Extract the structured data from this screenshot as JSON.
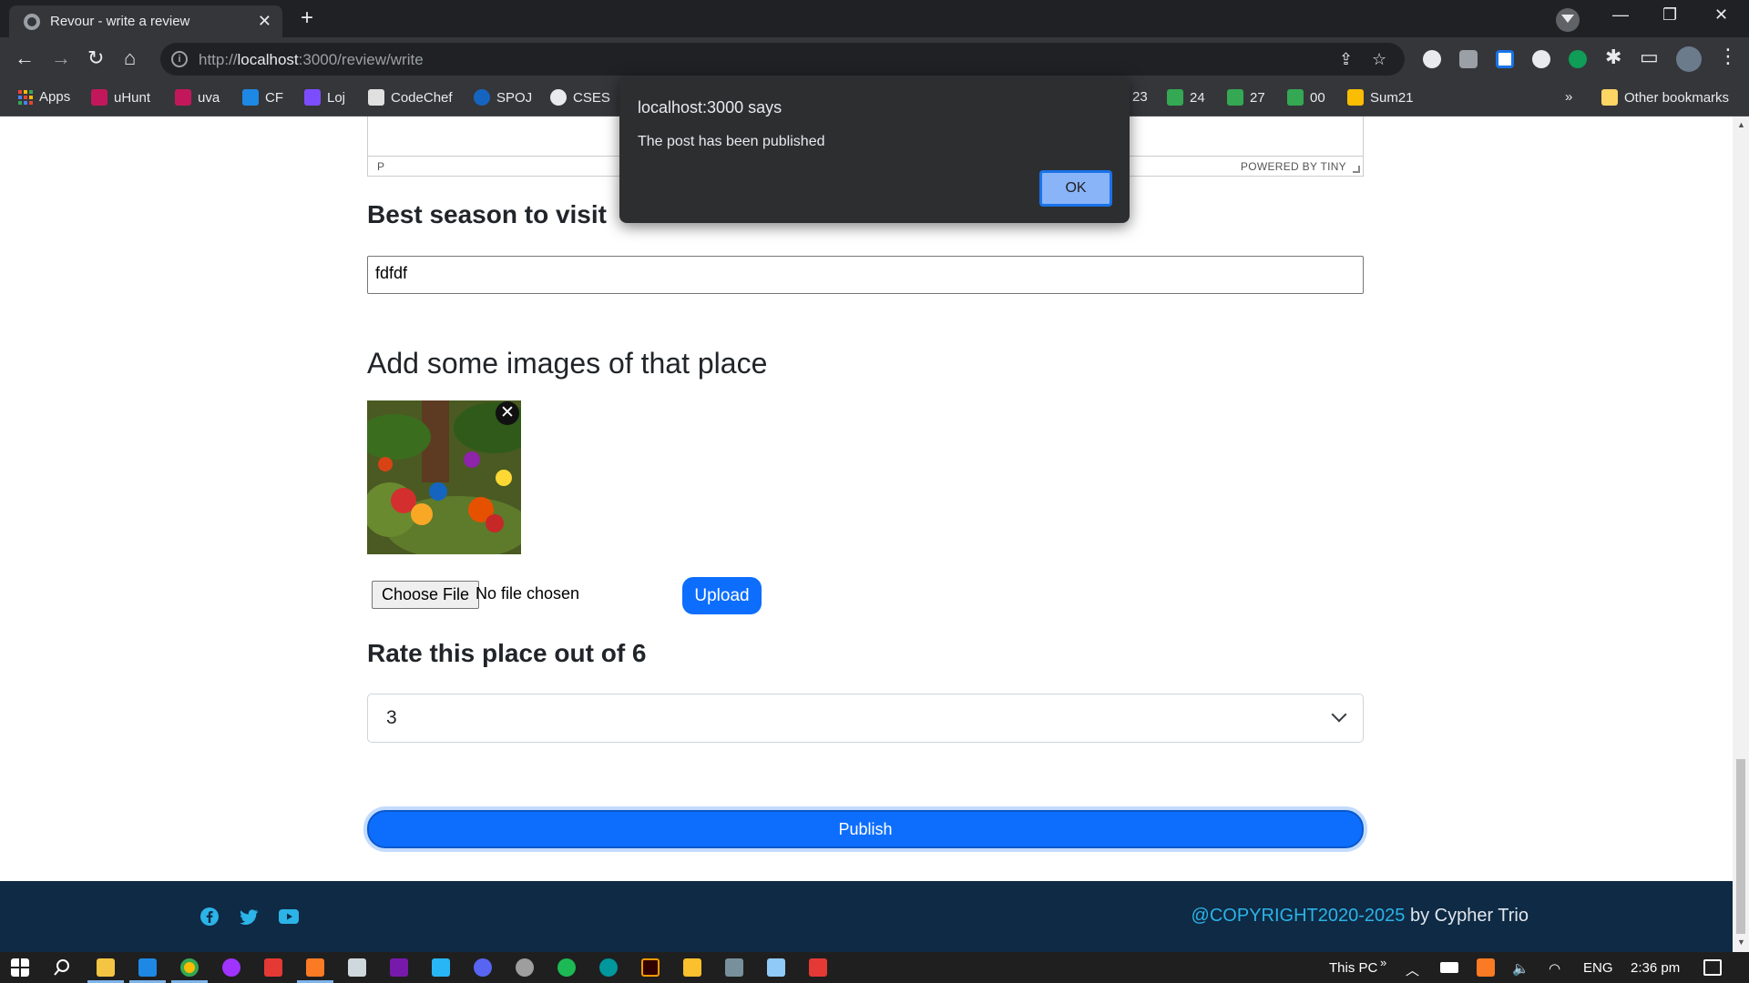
{
  "browser": {
    "tab_title": "Revour - write a review",
    "tab_close": "✕",
    "new_tab": "+",
    "url_host": "http://",
    "url_domain": "localhost",
    "url_rest": ":3000/review/write",
    "window_controls": {
      "minimize": "—",
      "restore": "❐",
      "close": "✕"
    }
  },
  "bookmarks": {
    "items": [
      {
        "label": "Apps"
      },
      {
        "label": "uHunt"
      },
      {
        "label": "uva"
      },
      {
        "label": "CF"
      },
      {
        "label": "Loj"
      },
      {
        "label": "CodeChef"
      },
      {
        "label": "SPOJ"
      },
      {
        "label": "CSES"
      },
      {
        "label": "23"
      },
      {
        "label": "24"
      },
      {
        "label": "27"
      },
      {
        "label": "00"
      },
      {
        "label": "Sum21"
      }
    ],
    "overflow": "»",
    "other": "Other bookmarks"
  },
  "editor": {
    "path": "P",
    "powered_by": "POWERED BY TINY"
  },
  "form": {
    "season_heading": "Best season to visit",
    "season_value": "fdfdf",
    "images_heading": "Add some images of that place",
    "remove_image": "✕",
    "choose_file_label": "Choose File",
    "no_file_text": "No file chosen",
    "upload_label": "Upload",
    "rate_heading": "Rate this place out of 6",
    "rate_value": "3",
    "publish_label": "Publish"
  },
  "footer": {
    "copyright_link": "@COPYRIGHT2020-2025",
    "copyright_rest": " by Cypher Trio"
  },
  "dialog": {
    "title": "localhost:3000 says",
    "message": "The post has been published",
    "ok_label": "OK"
  },
  "taskbar": {
    "this_pc": "This PC",
    "chevron": "»",
    "lang": "ENG",
    "time": "2:36 pm"
  },
  "colors": {
    "primary": "#0d6efd",
    "footer_bg": "#0e2a44",
    "link": "#2cb3e8",
    "dialog_bg": "#2d2e30"
  }
}
